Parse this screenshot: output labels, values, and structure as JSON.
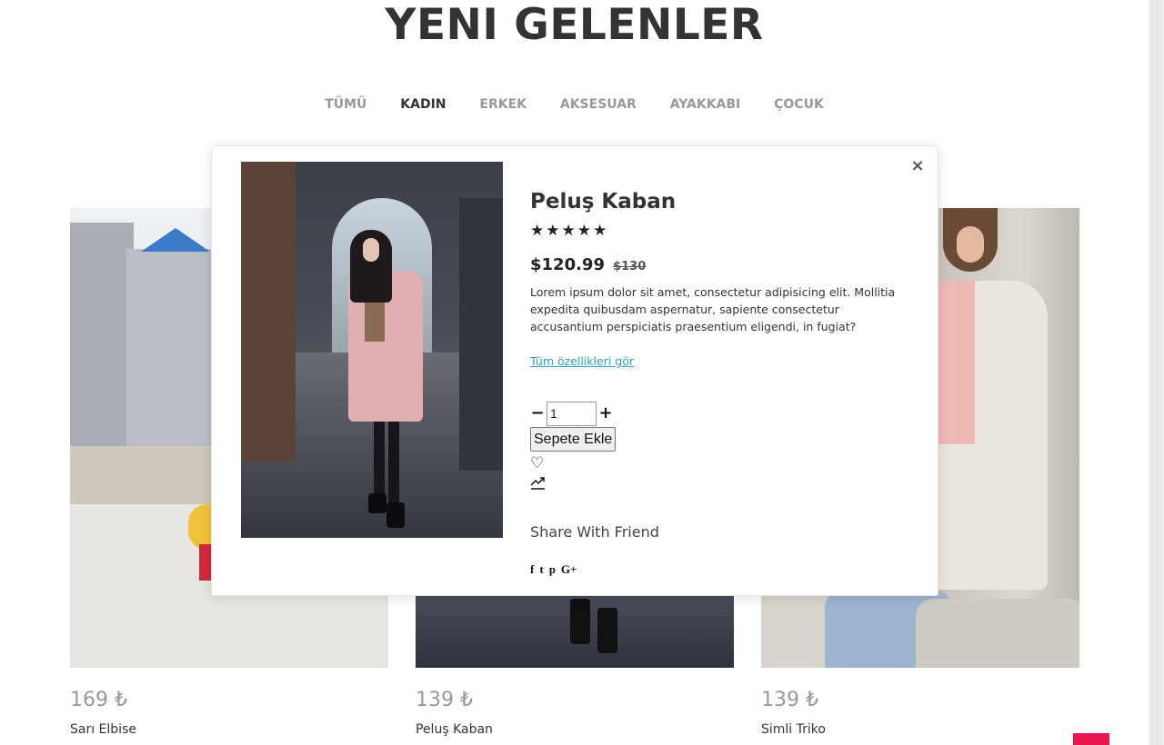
{
  "page": {
    "title": "YENI GELENLER",
    "categories": [
      {
        "label": "TÜMÜ",
        "active": false
      },
      {
        "label": "KADIN",
        "active": true
      },
      {
        "label": "ERKEK",
        "active": false
      },
      {
        "label": "AKSESUAR",
        "active": false
      },
      {
        "label": "AYAKKABI",
        "active": false
      },
      {
        "label": "ÇOCUK",
        "active": false
      }
    ]
  },
  "products": [
    {
      "price": "169 ₺",
      "name": "Sarı Elbise"
    },
    {
      "price": "139 ₺",
      "name": "Peluş Kaban"
    },
    {
      "price": "139 ₺",
      "name": "Simli Triko"
    }
  ],
  "modal": {
    "close_icon": "×",
    "title": "Peluş Kaban",
    "stars": "★★★★★",
    "rating": 5,
    "price": "$120.99",
    "old_price": "$130",
    "description": "Lorem ipsum dolor sit amet, consectetur adipisicing elit. Mollitia expedita quibusdam aspernatur, sapiente consectetur accusantium perspiciatis praesentium eligendi, in fugiat?",
    "details_link": "Tüm özellikleri gör",
    "qty_minus": "−",
    "qty_plus": "+",
    "quantity": "1",
    "add_to_cart": "Sepete Ekle",
    "wishlist_icon": "♡",
    "share_title": "Share With Friend",
    "share_icons": {
      "facebook": "f",
      "twitter": "t",
      "pinterest": "p",
      "google": "G+"
    }
  },
  "colors": {
    "accent_link": "#2aa3c7",
    "fab": "#e8174f",
    "text_dark": "#333333",
    "text_muted": "#999999"
  }
}
